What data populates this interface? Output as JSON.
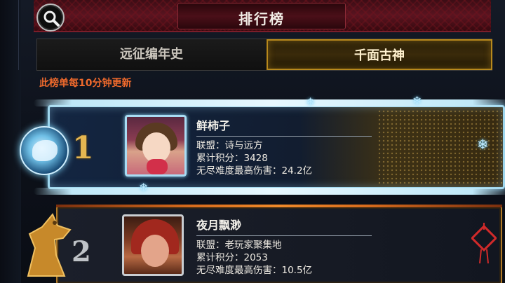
{
  "header": {
    "title": "排行榜",
    "search_icon": "search-icon"
  },
  "tabs": [
    {
      "label": "远征编年史",
      "active": false
    },
    {
      "label": "千面古神",
      "active": true
    }
  ],
  "notice": "此榜单每10分钟更新",
  "rankings": [
    {
      "rank": "1",
      "name": "鲜柿子",
      "alliance": "联盟：诗与远方",
      "score": "累计积分：3428",
      "damage": "无尽难度最高伤害：24.2亿"
    },
    {
      "rank": "2",
      "name": "夜月飘渺",
      "alliance": "联盟：老玩家聚集地",
      "score": "累计积分：2053",
      "damage": "无尽难度最高伤害：10.5亿"
    }
  ],
  "colors": {
    "accent_gold": "#b8891c",
    "notice_orange": "#f06a2c",
    "ice_blue": "#9fd7ee"
  }
}
